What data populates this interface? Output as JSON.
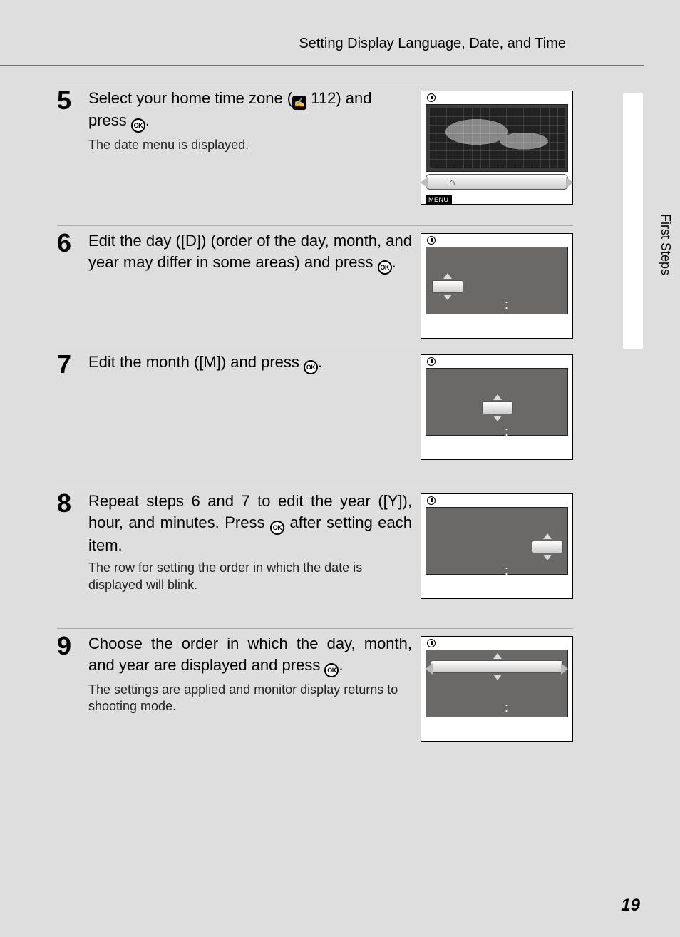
{
  "header": {
    "title": "Setting Display Language, Date, and Time"
  },
  "side_label": "First Steps",
  "page_number": "19",
  "ok_label": "OK",
  "ref_glyph": "✍",
  "menu_label": "MENU",
  "steps": [
    {
      "num": "5",
      "head_a": "Select your home time zone (",
      "head_b": " 112) and press ",
      "head_c": ".",
      "sub": "The date menu is displayed."
    },
    {
      "num": "6",
      "head_a": "Edit the day ([D]) (order of the day, month, and year may differ in some areas) and press ",
      "head_b": "."
    },
    {
      "num": "7",
      "head_a": "Edit the month ([M]) and press ",
      "head_b": "."
    },
    {
      "num": "8",
      "head_a": "Repeat steps 6 and 7 to edit the year ([Y]), hour, and minutes. Press ",
      "head_b": " after setting each item.",
      "sub": "The row for setting the order in which the date is displayed will blink."
    },
    {
      "num": "9",
      "head_a": "Choose the order in which the day, month, and year are displayed and press ",
      "head_b": ".",
      "sub": "The settings are applied and monitor display returns to shooting mode."
    }
  ]
}
